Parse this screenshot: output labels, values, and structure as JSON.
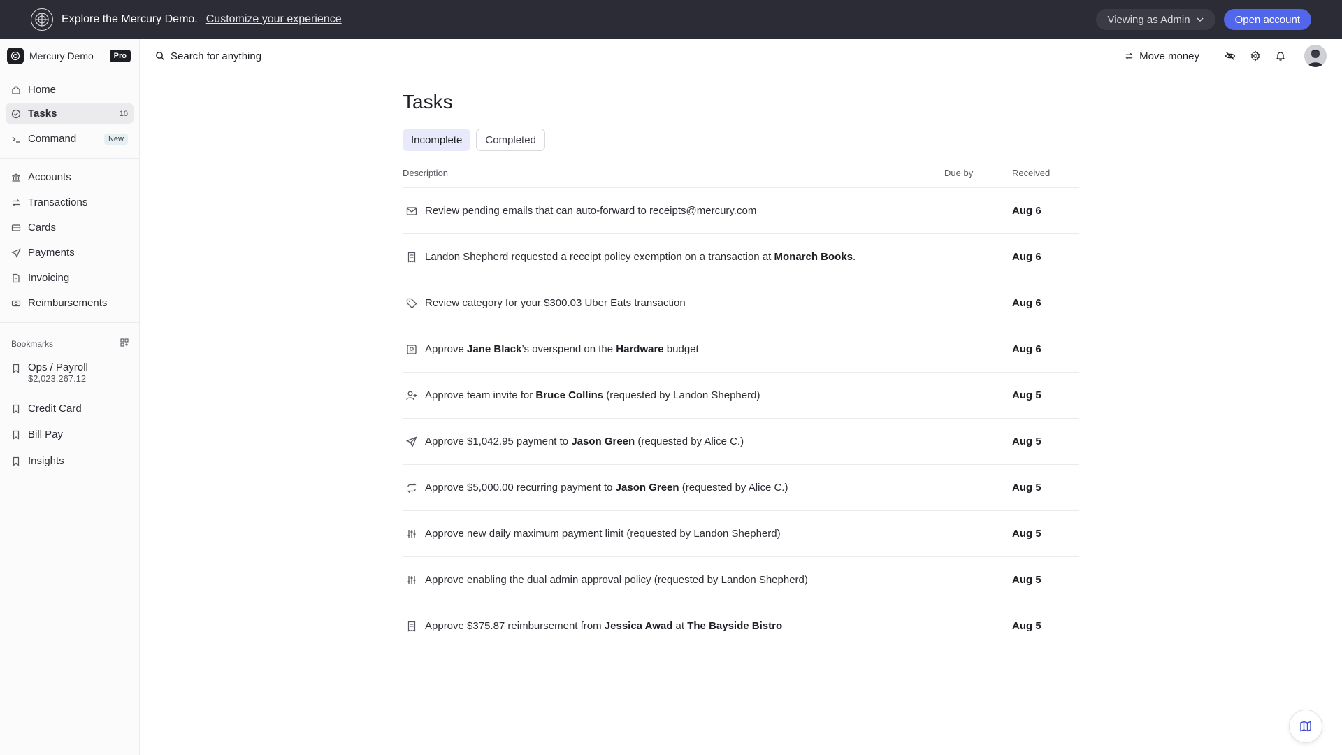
{
  "banner": {
    "title": "Explore the Mercury Demo.",
    "link": "Customize your experience",
    "viewing": "Viewing as Admin",
    "open_account": "Open account"
  },
  "org": {
    "name": "Mercury Demo",
    "badge": "Pro"
  },
  "nav": {
    "home": "Home",
    "tasks": "Tasks",
    "tasks_count": "10",
    "command": "Command",
    "command_badge": "New",
    "accounts": "Accounts",
    "transactions": "Transactions",
    "cards": "Cards",
    "payments": "Payments",
    "invoicing": "Invoicing",
    "reimbursements": "Reimbursements"
  },
  "bookmarks": {
    "header": "Bookmarks",
    "items": [
      {
        "label": "Ops / Payroll",
        "sub": "$2,023,267.12"
      },
      {
        "label": "Credit Card"
      },
      {
        "label": "Bill Pay"
      },
      {
        "label": "Insights"
      }
    ]
  },
  "header": {
    "search": "Search for anything",
    "move_money": "Move money"
  },
  "page": {
    "title": "Tasks",
    "tabs": {
      "incomplete": "Incomplete",
      "completed": "Completed"
    },
    "columns": {
      "description": "Description",
      "due": "Due by",
      "received": "Received"
    }
  },
  "tasks": [
    {
      "icon": "mail-icon",
      "date": "Aug 6",
      "parts": [
        {
          "t": "Review pending emails that can auto-forward to receipts@mercury.com"
        }
      ]
    },
    {
      "icon": "receipt-icon",
      "date": "Aug 6",
      "parts": [
        {
          "t": "Landon Shepherd requested a receipt policy exemption on a transaction at "
        },
        {
          "t": "Monarch Books",
          "b": true
        },
        {
          "t": "."
        }
      ]
    },
    {
      "icon": "tag-icon",
      "date": "Aug 6",
      "parts": [
        {
          "t": "Review category for your $300.03 Uber Eats transaction"
        }
      ]
    },
    {
      "icon": "budget-icon",
      "date": "Aug 6",
      "parts": [
        {
          "t": "Approve "
        },
        {
          "t": "Jane Black",
          "b": true
        },
        {
          "t": "’s overspend on the "
        },
        {
          "t": "Hardware",
          "b": true
        },
        {
          "t": " budget"
        }
      ]
    },
    {
      "icon": "user-plus-icon",
      "date": "Aug 5",
      "parts": [
        {
          "t": "Approve team invite for "
        },
        {
          "t": "Bruce Collins",
          "b": true
        },
        {
          "t": " (requested by Landon Shepherd)"
        }
      ]
    },
    {
      "icon": "send-icon",
      "date": "Aug 5",
      "parts": [
        {
          "t": "Approve $1,042.95 payment to "
        },
        {
          "t": "Jason Green",
          "b": true
        },
        {
          "t": " (requested by Alice C.)"
        }
      ]
    },
    {
      "icon": "repeat-icon",
      "date": "Aug 5",
      "parts": [
        {
          "t": "Approve $5,000.00 recurring payment to "
        },
        {
          "t": "Jason Green",
          "b": true
        },
        {
          "t": " (requested by Alice C.)"
        }
      ]
    },
    {
      "icon": "sliders-icon",
      "date": "Aug 5",
      "parts": [
        {
          "t": "Approve new daily maximum payment limit (requested by Landon Shepherd)"
        }
      ]
    },
    {
      "icon": "sliders-icon",
      "date": "Aug 5",
      "parts": [
        {
          "t": "Approve enabling the dual admin approval policy (requested by Landon Shepherd)"
        }
      ]
    },
    {
      "icon": "receipt-icon",
      "date": "Aug 5",
      "parts": [
        {
          "t": "Approve $375.87 reimbursement from "
        },
        {
          "t": "Jessica Awad",
          "b": true
        },
        {
          "t": " at "
        },
        {
          "t": "The Bayside Bistro",
          "b": true
        }
      ]
    }
  ]
}
